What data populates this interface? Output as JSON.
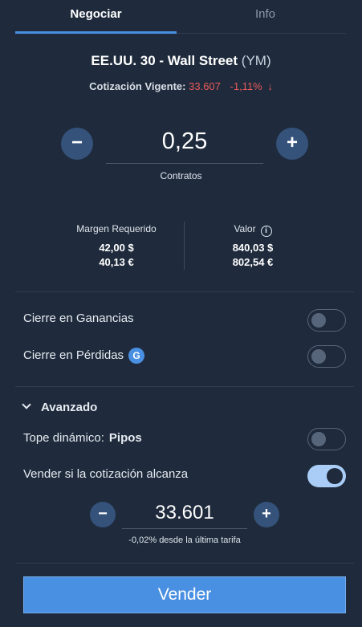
{
  "tabs": {
    "trade": "Negociar",
    "info": "Info"
  },
  "instrument": {
    "name": "EE.UU. 30 - Wall Street",
    "code": "(YM)"
  },
  "quote": {
    "label": "Cotización Vigente:",
    "price": "33.607",
    "change": "-1,11%",
    "arrow": "↓"
  },
  "quantity": {
    "minus": "−",
    "plus": "+",
    "value": "0,25",
    "label": "Contratos"
  },
  "metrics": {
    "margin": {
      "label": "Margen Requerido",
      "usd": "42,00 $",
      "eur": "40,13 €"
    },
    "value": {
      "label": "Valor",
      "info": "i",
      "usd": "840,03 $",
      "eur": "802,54 €"
    }
  },
  "take_profit": {
    "label": "Cierre en Ganancias",
    "enabled": false
  },
  "stop_loss": {
    "label": "Cierre en Pérdidas",
    "badge": "G",
    "enabled": false
  },
  "advanced": {
    "label": "Avanzado"
  },
  "trailing_stop": {
    "label": "Tope dinámico:",
    "unit": "Pipos",
    "enabled": false
  },
  "limit_order": {
    "label": "Vender si la cotización alcanza",
    "enabled": true
  },
  "limit_price": {
    "minus": "−",
    "plus": "+",
    "value": "33.601",
    "note": "-0,02%  desde la última tarifa"
  },
  "action": {
    "sell": "Vender"
  },
  "colors": {
    "background": "#1f2b3c",
    "accent": "#4a90e2",
    "negative": "#e85a5a",
    "toggle_on": "#a9cdf7"
  },
  "icons": {
    "info": "info-circle-icon",
    "chevron": "chevron-down-icon",
    "arrow": "arrow-down-icon"
  }
}
